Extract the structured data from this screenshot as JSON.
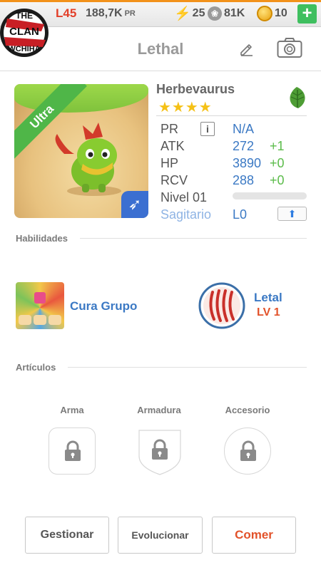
{
  "topbar": {
    "level": "L45",
    "power": "188,7K",
    "power_unit": "PR",
    "energy": "25",
    "friends": "81K",
    "coins": "10",
    "add_label": "+"
  },
  "logo": {
    "line1": "THE",
    "line2": "CLAN",
    "line3": "WCHIHA"
  },
  "header": {
    "title": "Lethal"
  },
  "creature": {
    "rarity": "Ultra",
    "name": "Herbevaurus",
    "stars": "★★★★",
    "element_icon": "leaf-icon",
    "stats": [
      {
        "label": "PR",
        "value": "N/A",
        "bonus": ""
      },
      {
        "label": "ATK",
        "value": "272",
        "bonus": "+1"
      },
      {
        "label": "HP",
        "value": "3890",
        "bonus": "+0"
      },
      {
        "label": "RCV",
        "value": "288",
        "bonus": "+0"
      }
    ],
    "level_label": "Nivel 01",
    "level_progress": 0,
    "sign_label": "Sagitario",
    "sign_level": "L0",
    "info_glyph": "i"
  },
  "abilities": {
    "title": "Habilidades",
    "skill": {
      "name": "Cura Grupo"
    },
    "passive": {
      "name": "Letal",
      "level": "LV 1"
    }
  },
  "items": {
    "title": "Artículos",
    "slots": [
      "Arma",
      "Armadura",
      "Accesorio"
    ]
  },
  "actions": {
    "manage": "Gestionar",
    "evolve": "Evolucionar",
    "eat": "Comer"
  },
  "colors": {
    "accent_blue": "#3b79c4",
    "bonus_green": "#5cbc4b",
    "level_red": "#e2402a",
    "ribbon_green": "#4fb648"
  }
}
